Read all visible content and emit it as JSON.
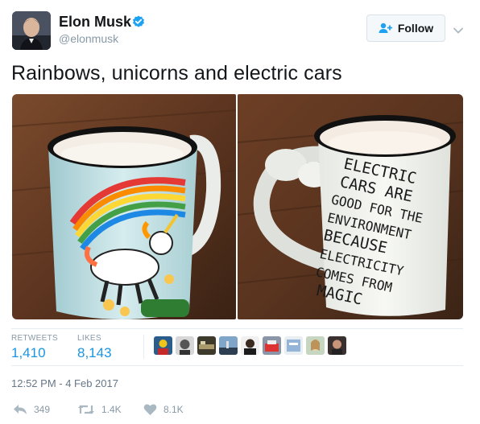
{
  "user": {
    "name": "Elon Musk",
    "handle": "@elonmusk",
    "verified": true,
    "follow_label": "Follow"
  },
  "tweet": {
    "text": "Rainbows, unicorns and electric cars",
    "mug_inscription": [
      "ELECTRIC",
      "CARS ARE",
      "GOOD FOR THE",
      "ENVIRONMENT",
      "BECAUSE",
      "ELECTRICITY",
      "COMES FROM",
      "MAGIC"
    ]
  },
  "stats": {
    "retweets_label": "RETWEETS",
    "retweets_value": "1,410",
    "likes_label": "LIKES",
    "likes_value": "8,143",
    "liker_count": 9
  },
  "timestamp": "12:52 PM - 4 Feb 2017",
  "actions": {
    "reply_count": "349",
    "retweet_count": "1.4K",
    "like_count": "8.1K"
  },
  "icons": {
    "verified": "verified-badge-icon",
    "follow": "add-user-icon",
    "more": "chevron-down-icon",
    "reply": "reply-icon",
    "retweet": "retweet-icon",
    "like": "heart-icon"
  },
  "colors": {
    "link_blue": "#1b95e0",
    "verified_blue": "#1da1f2",
    "muted_gray": "#8899a6",
    "border": "#e6ecf0"
  }
}
